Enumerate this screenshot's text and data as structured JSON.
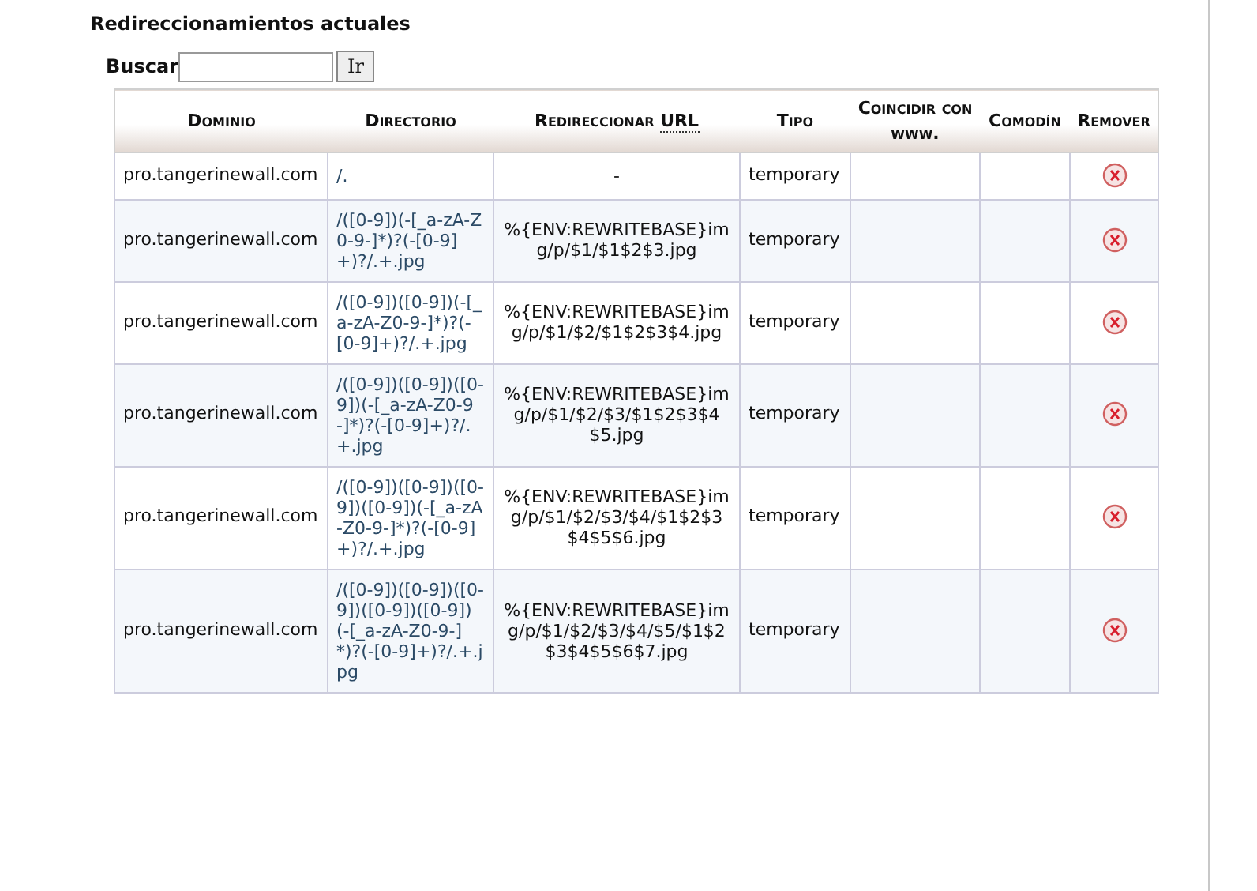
{
  "title": "Redireccionamientos actuales",
  "search": {
    "label": "Buscar",
    "button": "Ir"
  },
  "table": {
    "columns": [
      {
        "label": "Dominio"
      },
      {
        "label": "Directorio"
      },
      {
        "label": "Redireccionar",
        "abbr": "URL"
      },
      {
        "label": "Tipo"
      },
      {
        "label": "Coincidir con www."
      },
      {
        "label": "Comodín"
      },
      {
        "label": "Remover"
      }
    ],
    "rows": [
      {
        "dominio": "pro.tangerinewall.com",
        "directorio": "/.",
        "url": "-",
        "tipo": "temporary"
      },
      {
        "dominio": "pro.tangerinewall.com",
        "directorio": "/([0-9])(-[_a-zA-Z0-9-]*)?(-[0-9]+)?/.+.jpg",
        "url": "%{ENV:REWRITEBASE}img/p/$1/$1$2$3.jpg",
        "tipo": "temporary"
      },
      {
        "dominio": "pro.tangerinewall.com",
        "directorio": "/([0-9])([0-9])(-[_a-zA-Z0-9-]*)?(-[0-9]+)?/.+.jpg",
        "url": "%{ENV:REWRITEBASE}img/p/$1/$2/$1$2$3$4.jpg",
        "tipo": "temporary"
      },
      {
        "dominio": "pro.tangerinewall.com",
        "directorio": "/([0-9])([0-9])([0-9])(-[_a-zA-Z0-9-]*)?(-[0-9]+)?/.+.jpg",
        "url": "%{ENV:REWRITEBASE}img/p/$1/$2/$3/$1$2$3$4$5.jpg",
        "tipo": "temporary"
      },
      {
        "dominio": "pro.tangerinewall.com",
        "directorio": "/([0-9])([0-9])([0-9])([0-9])(-[_a-zA-Z0-9-]*)?(-[0-9]+)?/.+.jpg",
        "url": "%{ENV:REWRITEBASE}img/p/$1/$2/$3/$4/$1$2$3$4$5$6.jpg",
        "tipo": "temporary"
      },
      {
        "dominio": "pro.tangerinewall.com",
        "directorio": "/([0-9])([0-9])([0-9])([0-9])([0-9])(-[_a-zA-Z0-9-]*)?(-[0-9]+)?/.+.jpg",
        "url": "%{ENV:REWRITEBASE}img/p/$1/$2/$3/$4/$5/$1$2$3$4$5$6$7.jpg",
        "tipo": "temporary"
      }
    ]
  }
}
